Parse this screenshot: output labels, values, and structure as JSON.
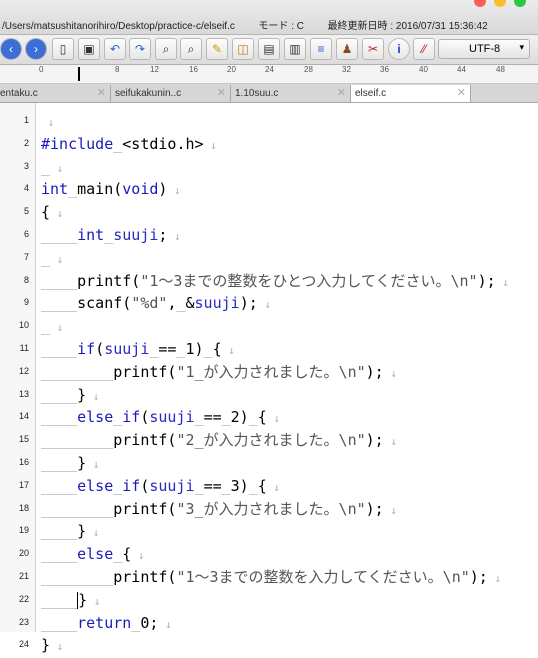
{
  "window": {
    "path": "/Users/matsushitanorihiro/Desktop/practice-c/elseif.c",
    "mode": "モード : C",
    "modified": "最終更新日時 : 2016/07/31 15:36:42"
  },
  "toolbar": {
    "encoding": "UTF-8",
    "buttons": [
      "back-icon",
      "forward-icon",
      "new-document-icon",
      "save-icon",
      "undo-icon",
      "redo-icon",
      "find-icon",
      "replace-icon",
      "highlight-icon",
      "screenshot-icon",
      "window-icon",
      "split-window-icon",
      "align-icon",
      "stamp-icon",
      "compare-icon",
      "info-icon",
      "no-wrap-icon"
    ]
  },
  "ruler": {
    "ticks": [
      "0",
      "8",
      "12",
      "16",
      "20",
      "24",
      "28",
      "32",
      "36",
      "40",
      "44",
      "48"
    ]
  },
  "tabs": [
    {
      "label": "entaku.c",
      "active": false
    },
    {
      "label": "seifukakunin..c",
      "active": false
    },
    {
      "label": "1.10suu.c",
      "active": false
    },
    {
      "label": "elseif.c",
      "active": true
    }
  ],
  "lines": [
    {
      "n": "1",
      "segments": []
    },
    {
      "n": "2",
      "segments": [
        [
          "pp",
          "#include"
        ],
        [
          "sp",
          "_"
        ],
        [
          "fn",
          "<stdio.h>"
        ]
      ]
    },
    {
      "n": "3",
      "segments": [
        [
          "sp",
          "_"
        ]
      ]
    },
    {
      "n": "4",
      "segments": [
        [
          "kw",
          "int"
        ],
        [
          "sp",
          "_"
        ],
        [
          "fn",
          "main"
        ],
        [
          "fn",
          "("
        ],
        [
          "kw",
          "void"
        ],
        [
          "fn",
          ")"
        ]
      ]
    },
    {
      "n": "5",
      "segments": [
        [
          "fn",
          "{"
        ]
      ]
    },
    {
      "n": "6",
      "segments": [
        [
          "sp",
          "____"
        ],
        [
          "kw",
          "int"
        ],
        [
          "sp",
          "_"
        ],
        [
          "var",
          "suuji"
        ],
        [
          "fn",
          ";"
        ]
      ]
    },
    {
      "n": "7",
      "segments": [
        [
          "sp",
          "_"
        ]
      ]
    },
    {
      "n": "8",
      "segments": [
        [
          "sp",
          "____"
        ],
        [
          "fn",
          "printf("
        ],
        [
          "str",
          "\"1〜3までの整数をひとつ入力してください。\\n\""
        ],
        [
          "fn",
          ");"
        ]
      ]
    },
    {
      "n": "9",
      "segments": [
        [
          "sp",
          "____"
        ],
        [
          "fn",
          "scanf("
        ],
        [
          "str",
          "\"%d\""
        ],
        [
          "fn",
          ","
        ],
        [
          "sp",
          "_"
        ],
        [
          "fn",
          "&"
        ],
        [
          "var",
          "suuji"
        ],
        [
          "fn",
          ");"
        ]
      ]
    },
    {
      "n": "10",
      "segments": [
        [
          "sp",
          "_"
        ]
      ]
    },
    {
      "n": "11",
      "segments": [
        [
          "sp",
          "____"
        ],
        [
          "kw",
          "if"
        ],
        [
          "fn",
          "("
        ],
        [
          "var",
          "suuji"
        ],
        [
          "sp",
          "_"
        ],
        [
          "fn",
          "=="
        ],
        [
          "sp",
          "_"
        ],
        [
          "fn",
          "1)"
        ],
        [
          "sp",
          "_"
        ],
        [
          "fn",
          "{"
        ]
      ]
    },
    {
      "n": "12",
      "segments": [
        [
          "sp",
          "________"
        ],
        [
          "fn",
          "printf("
        ],
        [
          "str",
          "\"1_が入力されました。\\n\""
        ],
        [
          "fn",
          ");"
        ]
      ]
    },
    {
      "n": "13",
      "segments": [
        [
          "sp",
          "____"
        ],
        [
          "fn",
          "}"
        ]
      ]
    },
    {
      "n": "14",
      "segments": [
        [
          "sp",
          "____"
        ],
        [
          "kw",
          "else"
        ],
        [
          "sp",
          "_"
        ],
        [
          "kw",
          "if"
        ],
        [
          "fn",
          "("
        ],
        [
          "var",
          "suuji"
        ],
        [
          "sp",
          "_"
        ],
        [
          "fn",
          "=="
        ],
        [
          "sp",
          "_"
        ],
        [
          "fn",
          "2)"
        ],
        [
          "sp",
          "_"
        ],
        [
          "fn",
          "{"
        ]
      ]
    },
    {
      "n": "15",
      "segments": [
        [
          "sp",
          "________"
        ],
        [
          "fn",
          "printf("
        ],
        [
          "str",
          "\"2_が入力されました。\\n\""
        ],
        [
          "fn",
          ");"
        ]
      ]
    },
    {
      "n": "16",
      "segments": [
        [
          "sp",
          "____"
        ],
        [
          "fn",
          "}"
        ]
      ]
    },
    {
      "n": "17",
      "segments": [
        [
          "sp",
          "____"
        ],
        [
          "kw",
          "else"
        ],
        [
          "sp",
          "_"
        ],
        [
          "kw",
          "if"
        ],
        [
          "fn",
          "("
        ],
        [
          "var",
          "suuji"
        ],
        [
          "sp",
          "_"
        ],
        [
          "fn",
          "=="
        ],
        [
          "sp",
          "_"
        ],
        [
          "fn",
          "3)"
        ],
        [
          "sp",
          "_"
        ],
        [
          "fn",
          "{"
        ]
      ]
    },
    {
      "n": "18",
      "segments": [
        [
          "sp",
          "________"
        ],
        [
          "fn",
          "printf("
        ],
        [
          "str",
          "\"3_が入力されました。\\n\""
        ],
        [
          "fn",
          ");"
        ]
      ]
    },
    {
      "n": "19",
      "segments": [
        [
          "sp",
          "____"
        ],
        [
          "fn",
          "}"
        ]
      ]
    },
    {
      "n": "20",
      "segments": [
        [
          "sp",
          "____"
        ],
        [
          "kw",
          "else"
        ],
        [
          "sp",
          "_"
        ],
        [
          "fn",
          "{"
        ]
      ]
    },
    {
      "n": "21",
      "segments": [
        [
          "sp",
          "________"
        ],
        [
          "fn",
          "printf("
        ],
        [
          "str",
          "\"1〜3までの整数を入力してください。\\n\""
        ],
        [
          "fn",
          ");"
        ]
      ]
    },
    {
      "n": "22",
      "segments": [
        [
          "sp",
          "____"
        ],
        [
          "caret",
          ""
        ],
        [
          "fn",
          "}"
        ]
      ]
    },
    {
      "n": "23",
      "segments": [
        [
          "sp",
          "____"
        ],
        [
          "kw",
          "return"
        ],
        [
          "sp",
          "_"
        ],
        [
          "fn",
          "0;"
        ]
      ]
    },
    {
      "n": "24",
      "segments": [
        [
          "fn",
          "}"
        ]
      ]
    }
  ],
  "colors": {
    "keyword": "#1a1ab8",
    "string": "#555555",
    "marker": "#b0b0b0"
  }
}
